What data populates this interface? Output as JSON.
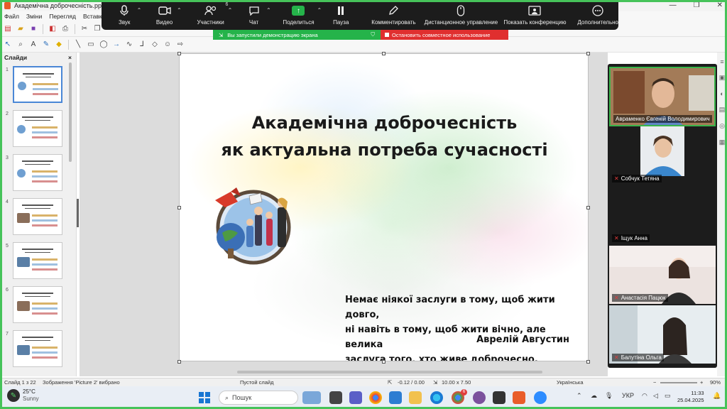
{
  "window": {
    "title": "Академічна доброчесність.pptx —",
    "controls": [
      "—",
      "❐",
      "✕"
    ]
  },
  "menu": [
    "Файл",
    "Зміни",
    "Перегляд",
    "Вставка"
  ],
  "zoom_toolbar": {
    "items": [
      {
        "label": "Звук",
        "icon": "microphone-icon"
      },
      {
        "label": "Видео",
        "icon": "camera-icon"
      },
      {
        "label": "Участники",
        "icon": "participants-icon",
        "count": "6"
      },
      {
        "label": "Чат",
        "icon": "chat-icon"
      },
      {
        "label": "Поделиться",
        "icon": "share-screen-icon"
      },
      {
        "label": "Пауза",
        "icon": "pause-icon"
      },
      {
        "label": "Комментировать",
        "icon": "pen-icon"
      },
      {
        "label": "Дистанционное управление",
        "icon": "mouse-icon"
      },
      {
        "label": "Показать конференцию",
        "icon": "meeting-icon"
      },
      {
        "label": "Дополнительно",
        "icon": "more-icon"
      }
    ],
    "share_banner": "Вы запустили демонстрацию экрана",
    "stop_banner": "Остановить совместное использование",
    "accent": "#25b34a",
    "stop_color": "#e02f2f"
  },
  "slides_panel": {
    "title": "Слайди",
    "close": "×",
    "thumbs": [
      "1",
      "2",
      "3",
      "4",
      "5",
      "6",
      "7"
    ]
  },
  "slide": {
    "title_line1": "Академічна доброчесність",
    "title_line2": "як актуальна потреба сучасності",
    "quote_line1": "Немає ніякої заслуги в тому, щоб жити довго,",
    "quote_line2": "ні навіть в тому, щоб жити вічно, але велика",
    "quote_line3": "заслуга того, хто живе доброчесно.",
    "author": "Аврелій  Августин"
  },
  "participants": [
    {
      "name": "Авраменко Євгеній Володимирович",
      "muted": false,
      "active": true
    },
    {
      "name": "Собчук Тетяна",
      "muted": true,
      "active": false
    },
    {
      "name": "Іщук Анна",
      "muted": true,
      "active": false
    },
    {
      "name": "Анастасія Пацюк",
      "muted": true,
      "active": false
    },
    {
      "name": "Балутіна Ольга",
      "muted": true,
      "active": false
    }
  ],
  "statusbar": {
    "slide_count": "Слайд 1 з 22",
    "selection": "Зображення 'Picture 2' вибрано",
    "layout": "Пустой слайд",
    "position": "-0.12 / 0.00",
    "size": "10.00 x 7.50",
    "language": "Українська",
    "zoom": "90%"
  },
  "taskbar": {
    "temperature": "25°C",
    "weather": "Sunny",
    "search_placeholder": "Пошук",
    "lang": "УКР",
    "time": "11:33",
    "date": "25.04.2025",
    "badge": "6"
  }
}
